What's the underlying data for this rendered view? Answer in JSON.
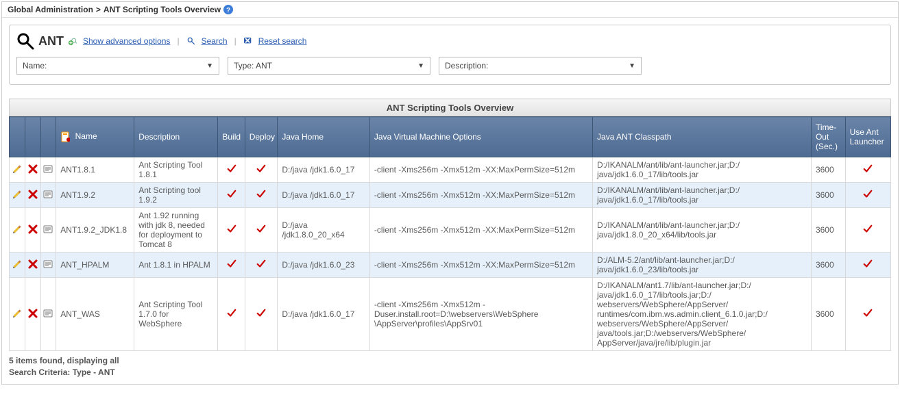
{
  "breadcrumb": {
    "root": "Global Administration",
    "separator": ">",
    "page": "ANT Scripting Tools Overview"
  },
  "searchPanel": {
    "title": "ANT",
    "advancedLabel": "Show advanced options",
    "searchLabel": "Search",
    "resetLabel": "Reset search",
    "filters": {
      "name": {
        "label": "Name:",
        "value": ""
      },
      "type": {
        "label": "Type:",
        "value": "ANT"
      },
      "description": {
        "label": "Description:",
        "value": ""
      }
    }
  },
  "tableTitle": "ANT Scripting Tools Overview",
  "columns": {
    "name": "Name",
    "description": "Description",
    "build": "Build",
    "deploy": "Deploy",
    "javaHome": "Java Home",
    "jvmOptions": "Java Virtual Machine Options",
    "classpath": "Java ANT Classpath",
    "timeout": "Time-Out (Sec.)",
    "launcher": "Use Ant Launcher"
  },
  "rows": [
    {
      "name": "ANT1.8.1",
      "description": "Ant Scripting Tool 1.8.1",
      "build": true,
      "deploy": true,
      "javaHome": "D:/java /jdk1.6.0_17",
      "jvmOptions": "-client -Xms256m -Xmx512m -XX:MaxPermSize=512m",
      "classpath": "D:/IKANALM/ant/lib/ant-launcher.jar;D:/ java/jdk1.6.0_17/lib/tools.jar",
      "timeout": "3600",
      "launcher": true
    },
    {
      "name": "ANT1.9.2",
      "description": "Ant Scripting tool 1.9.2",
      "build": true,
      "deploy": true,
      "javaHome": "D:/java /jdk1.6.0_17",
      "jvmOptions": "-client -Xms256m -Xmx512m -XX:MaxPermSize=512m",
      "classpath": "D:/IKANALM/ant/lib/ant-launcher.jar;D:/ java/jdk1.6.0_17/lib/tools.jar",
      "timeout": "3600",
      "launcher": true
    },
    {
      "name": "ANT1.9.2_JDK1.8",
      "description": "Ant 1.92 running with jdk 8, needed for deployment to Tomcat 8",
      "build": true,
      "deploy": true,
      "javaHome": "D:/java /jdk1.8.0_20_x64",
      "jvmOptions": "-client -Xms256m -Xmx512m -XX:MaxPermSize=512m",
      "classpath": "D:/IKANALM/ant/lib/ant-launcher.jar;D:/ java/jdk1.8.0_20_x64/lib/tools.jar",
      "timeout": "3600",
      "launcher": true
    },
    {
      "name": "ANT_HPALM",
      "description": "Ant 1.8.1 in HPALM",
      "build": true,
      "deploy": true,
      "javaHome": "D:/java /jdk1.6.0_23",
      "jvmOptions": "-client -Xms256m -Xmx512m -XX:MaxPermSize=512m",
      "classpath": "D:/ALM-5.2/ant/lib/ant-launcher.jar;D:/ java/jdk1.6.0_23/lib/tools.jar",
      "timeout": "3600",
      "launcher": true
    },
    {
      "name": "ANT_WAS",
      "description": "Ant Scripting Tool 1.7.0 for WebSphere",
      "build": true,
      "deploy": true,
      "javaHome": "D:/java /jdk1.6.0_17",
      "jvmOptions": "-client -Xms256m -Xmx512m -Duser.install.root=D:\\webservers\\WebSphere \\AppServer\\profiles\\AppSrv01",
      "classpath": "D:/IKANALM/ant1.7/lib/ant-launcher.jar;D:/ java/jdk1.6.0_17/lib/tools.jar;D:/ webservers/WebSphere/AppServer/ runtimes/com.ibm.ws.admin.client_6.1.0.jar;D:/ webservers/WebSphere/AppServer/ java/tools.jar;D:/webservers/WebSphere/ AppServer/java/jre/lib/plugin.jar",
      "timeout": "3600",
      "launcher": true
    }
  ],
  "footer": {
    "countLine": "5 items found, displaying all",
    "criteriaLine": "Search Criteria: Type - ANT"
  }
}
